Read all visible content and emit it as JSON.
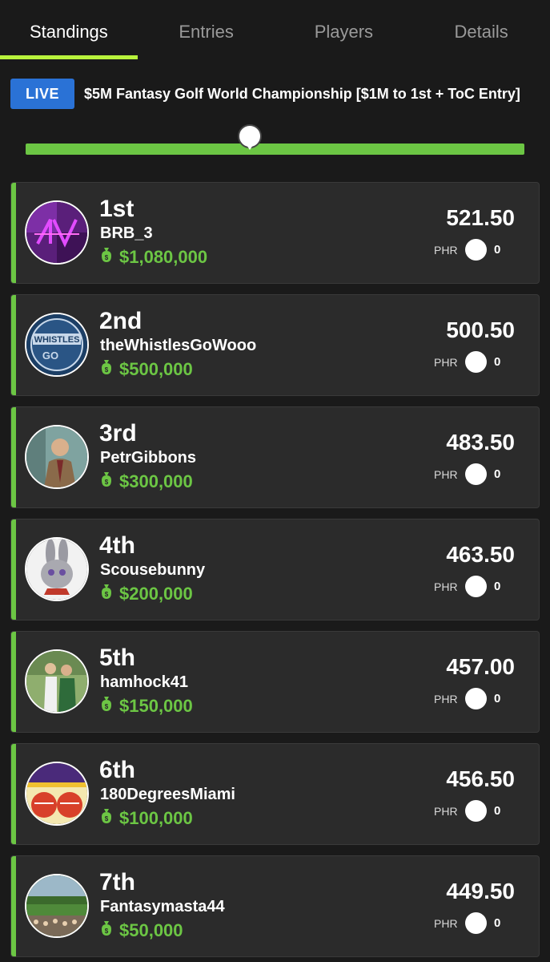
{
  "tabs": [
    {
      "label": "Standings",
      "active": true
    },
    {
      "label": "Entries",
      "active": false
    },
    {
      "label": "Players",
      "active": false
    },
    {
      "label": "Details",
      "active": false
    }
  ],
  "header": {
    "live_badge": "LIVE",
    "contest_title": "$5M Fantasy Golf World Championship [$1M to 1st + ToC Entry]"
  },
  "progress": {
    "fraction": 0.45
  },
  "colors": {
    "accent_green": "#6cc644",
    "tab_underline": "#b8f23c",
    "live_blue": "#2a72d6"
  },
  "standings": [
    {
      "rank": "1st",
      "name": "BRB_3",
      "prize": "$1,080,000",
      "score": "521.50",
      "phr_label": "PHR",
      "phr": "0",
      "avatar": "purple-logo-avatar"
    },
    {
      "rank": "2nd",
      "name": "theWhistlesGoWooo",
      "prize": "$500,000",
      "score": "500.50",
      "phr_label": "PHR",
      "phr": "0",
      "avatar": "whistles-logo-avatar"
    },
    {
      "rank": "3rd",
      "name": "PetrGibbons",
      "prize": "$300,000",
      "score": "483.50",
      "phr_label": "PHR",
      "phr": "0",
      "avatar": "man-in-office-avatar"
    },
    {
      "rank": "4th",
      "name": "Scousebunny",
      "prize": "$200,000",
      "score": "463.50",
      "phr_label": "PHR",
      "phr": "0",
      "avatar": "bunny-avatar"
    },
    {
      "rank": "5th",
      "name": "hamhock41",
      "prize": "$150,000",
      "score": "457.00",
      "phr_label": "PHR",
      "phr": "0",
      "avatar": "golfers-avatar"
    },
    {
      "rank": "6th",
      "name": "180DegreesMiami",
      "prize": "$100,000",
      "score": "456.50",
      "phr_label": "PHR",
      "phr": "0",
      "avatar": "helmets-avatar"
    },
    {
      "rank": "7th",
      "name": "Fantasymasta44",
      "prize": "$50,000",
      "score": "449.50",
      "phr_label": "PHR",
      "phr": "0",
      "avatar": "golf-crowd-avatar"
    }
  ]
}
